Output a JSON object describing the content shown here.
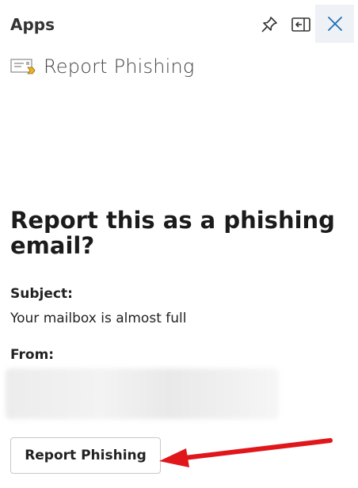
{
  "header": {
    "title": "Apps",
    "pin_icon": "pin-icon",
    "dock_icon": "dock-pane-icon",
    "close_icon": "close-icon",
    "accent": "#1d6fb8"
  },
  "addin": {
    "icon": "report-phishing-envelope-icon",
    "name": "Report Phishing"
  },
  "dialog": {
    "heading": "Report this as a phishing email?",
    "subject_label": "Subject:",
    "subject_value": "Your mailbox is almost full",
    "from_label": "From:",
    "button_label": "Report Phishing"
  },
  "annotation": {
    "arrow_color": "#e0161b"
  }
}
